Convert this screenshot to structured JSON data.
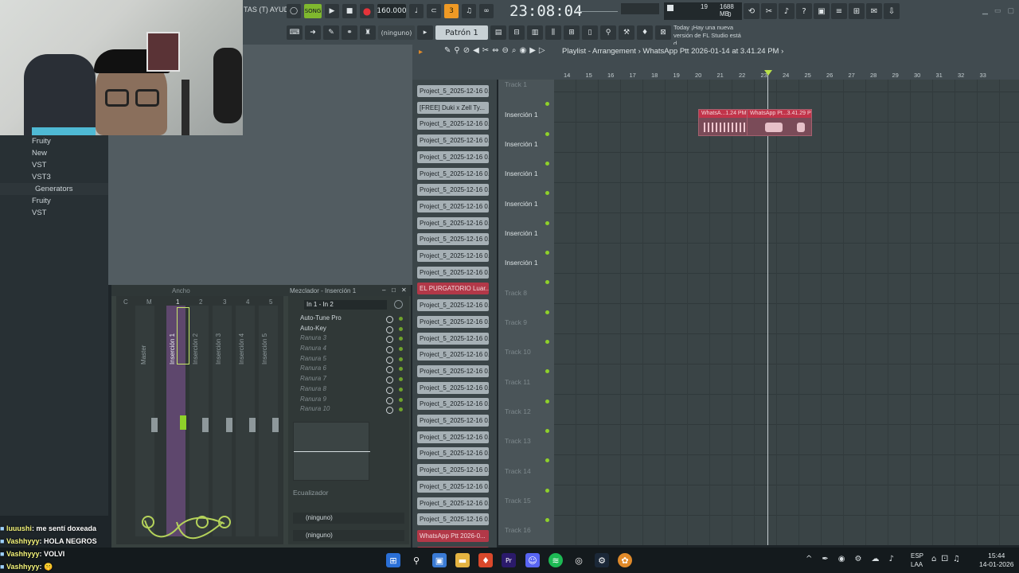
{
  "menu": {
    "tail": "TAS (T)  AYUDA"
  },
  "transport": {
    "song_label": "SONG",
    "tempo": "160.000",
    "time": "23:08:04",
    "sub": "B:S:T",
    "cpu": "19",
    "mem": "1688 MB",
    "poly": "0"
  },
  "toolbar": {
    "pattern": "Patrón 1",
    "ninguno": "(ninguno)"
  },
  "hint": {
    "line1": "Today  ¡Hay una nueva",
    "line2": "versión de FL Studio está d..."
  },
  "browser": {
    "items": [
      "Fruity",
      "New",
      "VST",
      "VST3",
      "Generators",
      "Fruity",
      "VST"
    ]
  },
  "mixer": {
    "header_left": "Ancho",
    "title": "Mezclador - Inserción 1",
    "labels": [
      "C",
      "M",
      "1",
      "2",
      "3",
      "4",
      "5"
    ],
    "strips": [
      "Master",
      "Inserción 1",
      "Inserción 2",
      "Inserción 3",
      "Inserción 4",
      "Inserción 5"
    ],
    "route": "In 1 - In 2",
    "slots": [
      "Auto-Tune Pro",
      "Auto-Key",
      "Ranura 3",
      "Ranura 4",
      "Ranura 5",
      "Ranura 6",
      "Ranura 7",
      "Ranura 8",
      "Ranura 9",
      "Ranura 10"
    ],
    "eq_label": "Ecualizador",
    "out1": "(ninguno)",
    "out2": "(ninguno)"
  },
  "patterns": [
    "Project_5_2025-12-16 0...",
    "[FREE] Duki x Zell Ty...",
    "Project_5_2025-12-16 0...",
    "Project_5_2025-12-16 0...",
    "Project_5_2025-12-16 0...",
    "Project_5_2025-12-16 0...",
    "Project_5_2025-12-16 0...",
    "Project_5_2025-12-16 0...",
    "Project_5_2025-12-16 0...",
    "Project_5_2025-12-16 0...",
    "Project_5_2025-12-16 0...",
    "Project_5_2025-12-16 0...",
    "EL PURGATORIO  Luar...",
    "Project_5_2025-12-16 0...",
    "Project_5_2025-12-16 0...",
    "Project_5_2025-12-16 0...",
    "Project_5_2025-12-16 0...",
    "Project_5_2025-12-16 0...",
    "Project_5_2025-12-16 0...",
    "Project_5_2025-12-16 0...",
    "Project_5_2025-12-16 0...",
    "Project_5_2025-12-16 0...",
    "Project_5_2025-12-16 0...",
    "Project_5_2025-12-16 0...",
    "Project_5_2025-12-16 0...",
    "Project_5_2025-12-16 0...",
    "Project_5_2025-12-16 0...",
    "WhatsApp Ptt 2026-0...",
    "WhatsApp Ptt 2026-0..."
  ],
  "playlist": {
    "title": "Playlist - Arrangement  ›  WhatsApp Ptt 2026-01-14 at 3.41.24 PM  ›"
  },
  "ruler": [
    "14",
    "15",
    "16",
    "17",
    "18",
    "19",
    "20",
    "21",
    "22",
    "23",
    "24",
    "25",
    "26",
    "27",
    "28",
    "29",
    "30",
    "31",
    "32",
    "33"
  ],
  "tracks": [
    "Track 1",
    "Inserción 1",
    "Inserción 1",
    "Inserción 1",
    "Inserción 1",
    "Inserción 1",
    "Inserción 1",
    "Track 8",
    "Track 9",
    "Track 10",
    "Track 11",
    "Track 12",
    "Track 13",
    "Track 14",
    "Track 15",
    "Track 16"
  ],
  "clips": [
    "WhatsA...1.24 PM",
    "WhatsApp Pt...3.41.29 PM"
  ],
  "chat": [
    {
      "user": "luuushi",
      "text": ": me sentí doxeada"
    },
    {
      "user": "Vashhyyy",
      "text": ": HOLA NEGROS"
    },
    {
      "user": "Vashhyyy",
      "text": ": VOLVI"
    },
    {
      "user": "Vashhyyy",
      "text": ": 🤫"
    }
  ],
  "taskbar": {
    "lang1": "ESP",
    "lang2": "LAA",
    "time": "15:44",
    "date": "14-01-2026"
  }
}
